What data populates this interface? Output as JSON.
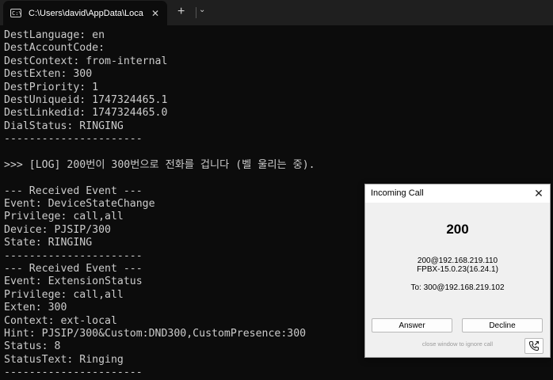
{
  "window": {
    "tab_icon_text": "C:\\",
    "tab_title": "C:\\Users\\david\\AppData\\Local",
    "tab_close_glyph": "✕",
    "new_tab_glyph": "+",
    "dropdown_glyph": "⌄"
  },
  "terminal": {
    "lines": [
      "DestLanguage: en",
      "DestAccountCode:",
      "DestContext: from-internal",
      "DestExten: 300",
      "DestPriority: 1",
      "DestUniqueid: 1747324465.1",
      "DestLinkedid: 1747324465.0",
      "DialStatus: RINGING",
      "----------------------",
      "",
      ">>> [LOG] 200번이 300번으로 전화를 겁니다 (벨 울리는 중).",
      "",
      "--- Received Event ---",
      "Event: DeviceStateChange",
      "Privilege: call,all",
      "Device: PJSIP/300",
      "State: RINGING",
      "----------------------",
      "--- Received Event ---",
      "Event: ExtensionStatus",
      "Privilege: call,all",
      "Exten: 300",
      "Context: ext-local",
      "Hint: PJSIP/300&Custom:DND300,CustomPresence:300",
      "Status: 8",
      "StatusText: Ringing",
      "----------------------"
    ]
  },
  "popup": {
    "title": "Incoming Call",
    "close_glyph": "✕",
    "caller_number": "200",
    "caller_uri": "200@192.168.219.110",
    "caller_agent": "FPBX-15.0.23(16.24.1)",
    "to_line": "To: 300@192.168.219.102",
    "answer_label": "Answer",
    "decline_label": "Decline",
    "hint": "close window to ignore call",
    "call_icon": "phone-forward-icon"
  }
}
